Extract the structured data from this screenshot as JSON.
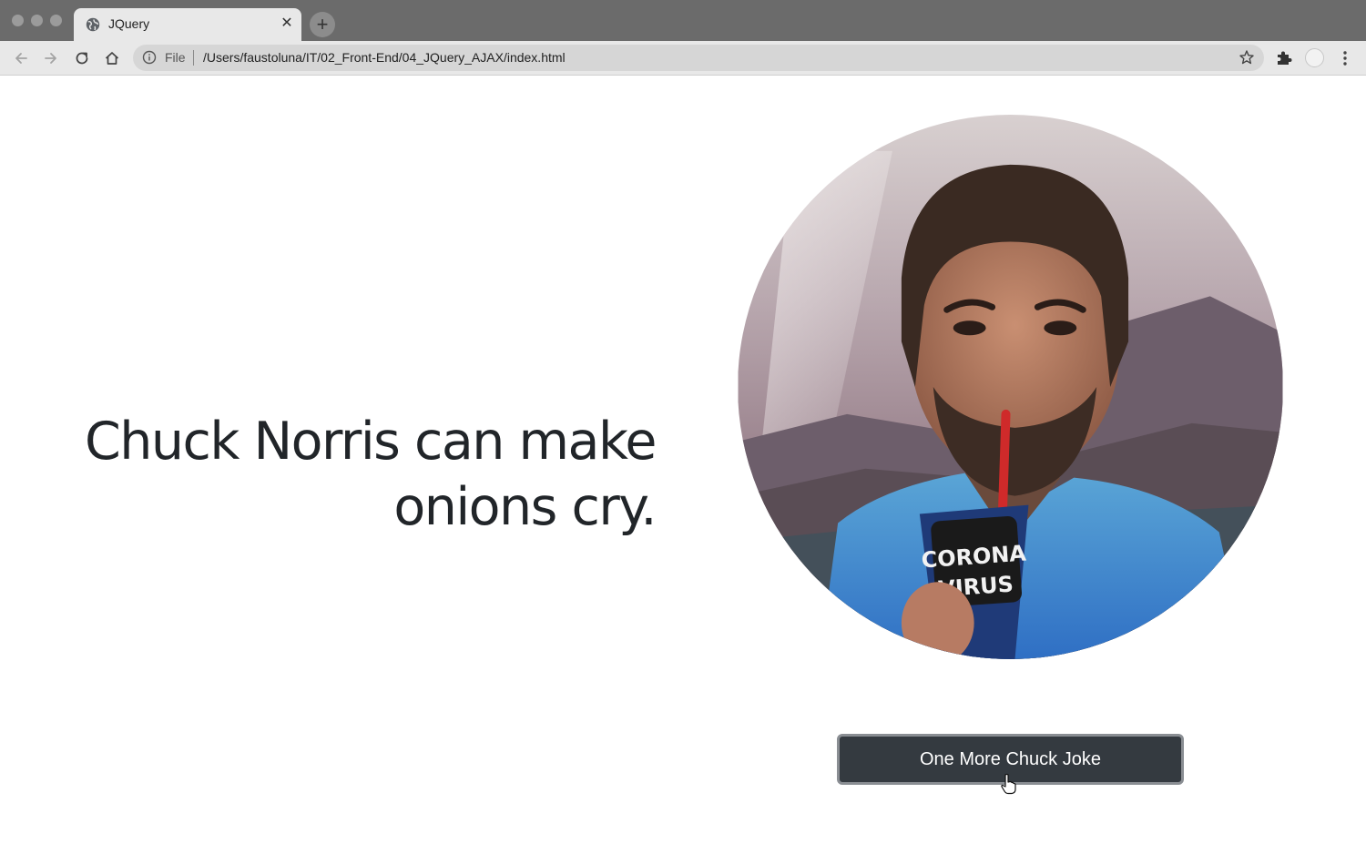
{
  "browser": {
    "tab_title": "JQuery",
    "tab_close": "✕",
    "new_tab": "+",
    "scheme_label": "File",
    "url": "/Users/faustoluna/IT/02_Front-End/04_JQuery_AJAX/index.html"
  },
  "icons": {
    "favicon": "globe-icon",
    "back": "arrow-left-icon",
    "forward": "arrow-right-icon",
    "reload": "reload-icon",
    "home": "home-icon",
    "info": "info-icon",
    "bookmark": "star-icon",
    "extensions": "puzzle-icon",
    "menu": "kebab-menu-icon",
    "cursor": "hand-pointer-icon"
  },
  "page": {
    "joke_text": "Chuck Norris can make onions cry.",
    "image_text_line1": "CORONA",
    "image_text_line2": "VIRUS",
    "button_label": "One More Chuck Joke"
  },
  "colors": {
    "button_bg": "#343a40",
    "text": "#212529",
    "titlebar": "#6b6b6b",
    "toolbar": "#e8e8e8"
  }
}
